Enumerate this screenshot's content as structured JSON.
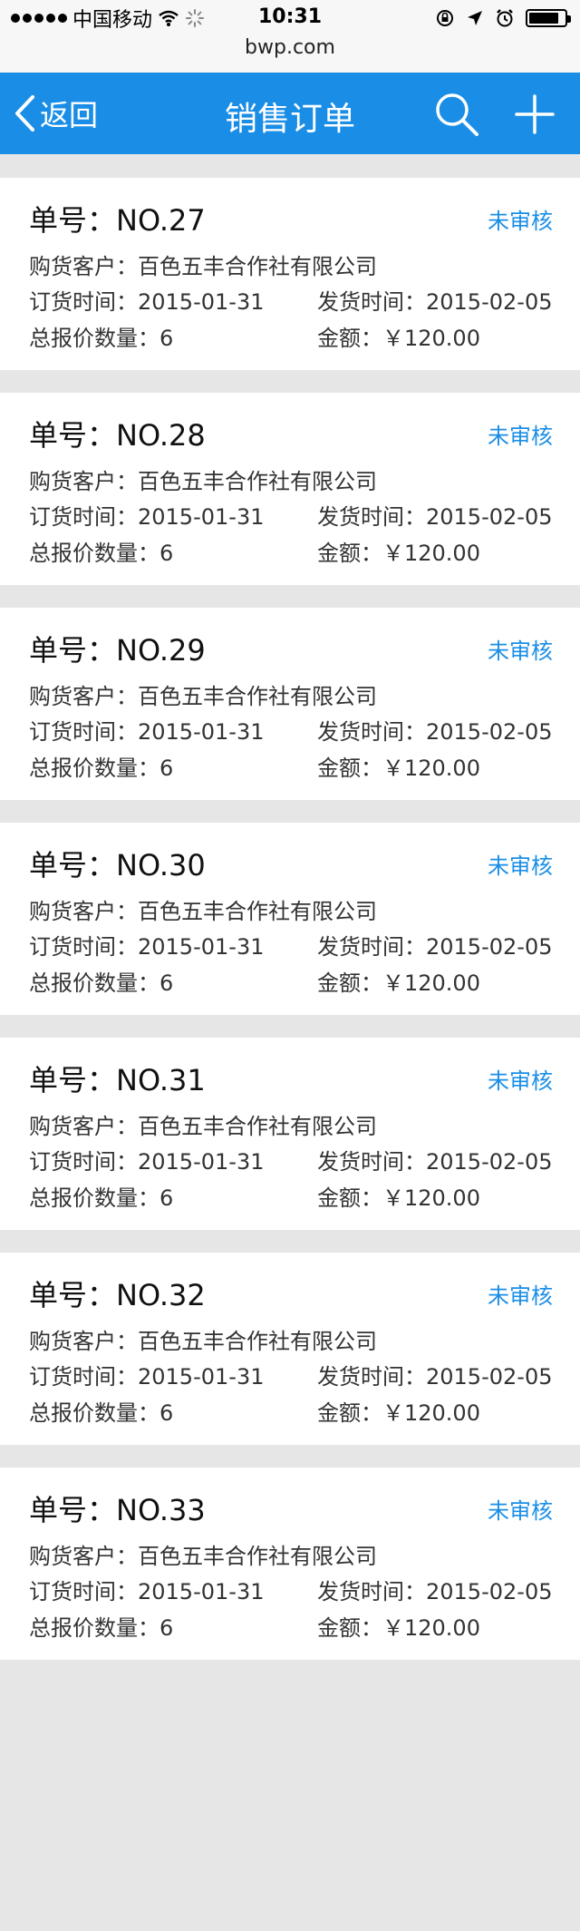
{
  "status_bar": {
    "carrier": "中国移动",
    "time": "10:31",
    "url": "bwp.com",
    "battery_level": 0.85,
    "signal_bars": 5
  },
  "nav": {
    "back_label": "返回",
    "title": "销售订单",
    "background_color": "#1a8ee6"
  },
  "labels": {
    "order_no_prefix": "单号：",
    "customer": "购货客户：",
    "order_date": "订货时间：",
    "ship_date": "发货时间：",
    "quantity": "总报价数量：",
    "amount": "金额："
  },
  "orders": [
    {
      "order_no": "NO.27",
      "status": "未审核",
      "customer": "百色五丰合作社有限公司",
      "order_date": "2015-01-31",
      "ship_date": "2015-02-05",
      "quantity": "6",
      "amount": "￥120.00"
    },
    {
      "order_no": "NO.28",
      "status": "未审核",
      "customer": "百色五丰合作社有限公司",
      "order_date": "2015-01-31",
      "ship_date": "2015-02-05",
      "quantity": "6",
      "amount": "￥120.00"
    },
    {
      "order_no": "NO.29",
      "status": "未审核",
      "customer": "百色五丰合作社有限公司",
      "order_date": "2015-01-31",
      "ship_date": "2015-02-05",
      "quantity": "6",
      "amount": "￥120.00"
    },
    {
      "order_no": "NO.30",
      "status": "未审核",
      "customer": "百色五丰合作社有限公司",
      "order_date": "2015-01-31",
      "ship_date": "2015-02-05",
      "quantity": "6",
      "amount": "￥120.00"
    },
    {
      "order_no": "NO.31",
      "status": "未审核",
      "customer": "百色五丰合作社有限公司",
      "order_date": "2015-01-31",
      "ship_date": "2015-02-05",
      "quantity": "6",
      "amount": "￥120.00"
    },
    {
      "order_no": "NO.32",
      "status": "未审核",
      "customer": "百色五丰合作社有限公司",
      "order_date": "2015-01-31",
      "ship_date": "2015-02-05",
      "quantity": "6",
      "amount": "￥120.00"
    },
    {
      "order_no": "NO.33",
      "status": "未审核",
      "customer": "百色五丰合作社有限公司",
      "order_date": "2015-01-31",
      "ship_date": "2015-02-05",
      "quantity": "6",
      "amount": "￥120.00"
    }
  ]
}
